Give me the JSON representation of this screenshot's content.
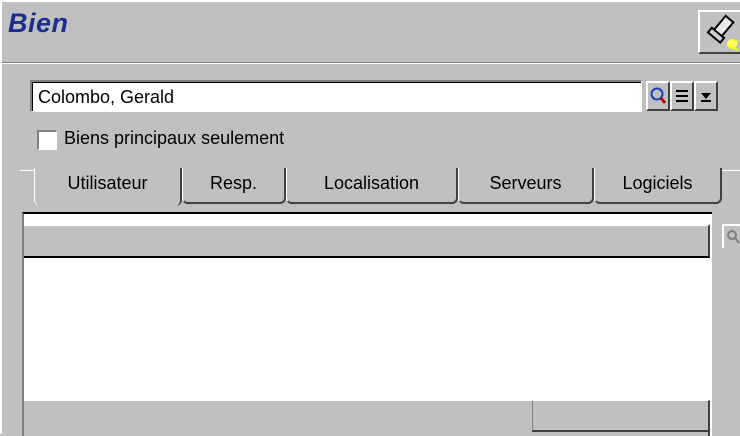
{
  "window": {
    "title": "Bien"
  },
  "user_field": {
    "value": "Colombo, Gerald"
  },
  "icons": {
    "flashlight": "flashlight-icon",
    "search": "magnifier-icon",
    "list": "list-icon",
    "dropdown": "dropdown-arrow-icon",
    "mini_search": "magnifier-icon"
  },
  "checkbox": {
    "label": "Biens principaux seulement",
    "checked": false
  },
  "tabs": [
    {
      "label": "Utilisateur",
      "active": true
    },
    {
      "label": "Resp.",
      "active": false
    },
    {
      "label": "Localisation",
      "active": false
    },
    {
      "label": "Serveurs",
      "active": false
    },
    {
      "label": "Logiciels",
      "active": false
    }
  ],
  "colors": {
    "title": "#1c2f8c",
    "face": "#c0c0c0",
    "search_icon": "#1a3fbf"
  }
}
